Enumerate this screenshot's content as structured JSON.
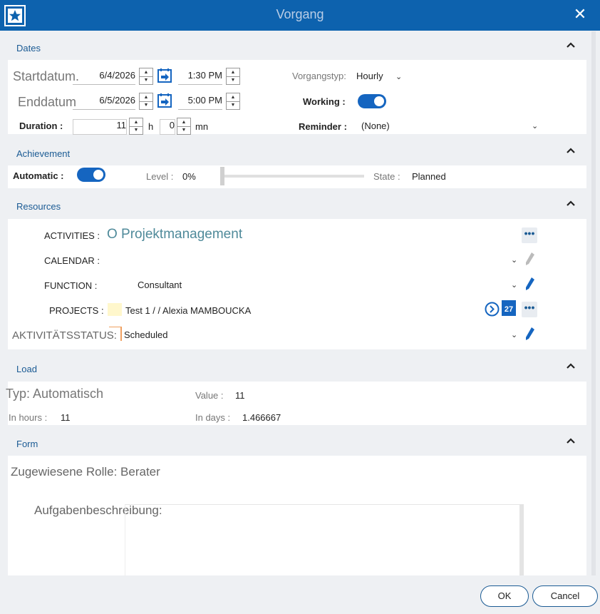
{
  "window": {
    "title": "Vorgang"
  },
  "dates": {
    "section_title": "Dates",
    "start_label": "Startdatum.",
    "start_date": "6/4/2026",
    "start_time": "1:30 PM",
    "end_label": "Enddatum",
    "end_date": "6/5/2026",
    "end_time": "5:00 PM",
    "duration_label": "Duration :",
    "duration_hours": "11",
    "hours_unit": "h",
    "duration_minutes": "0",
    "minutes_unit": "mn",
    "type_label": "Vorgangstyp:",
    "type_value": "Hourly",
    "working_label": "Working :",
    "reminder_label": "Reminder :",
    "reminder_value": "(None)"
  },
  "achievement": {
    "section_title": "Achievement",
    "automatic_label": "Automatic :",
    "level_label": "Level :",
    "level_value": "0%",
    "level_fraction": 0,
    "state_label": "State :",
    "state_value": "Planned"
  },
  "resources": {
    "section_title": "Resources",
    "activities_label": "ACTIVITIES :",
    "activities_value": "O Projektmanagement",
    "calendar_label": "CALENDAR :",
    "function_label": "FUNCTION :",
    "function_value": "Consultant",
    "projects_label": "PROJECTS :",
    "projects_value": "Test 1 /  / Alexia MAMBOUCKA",
    "calendar_badge": "27",
    "status_label": "AKTIVITÄTSSTATUS:",
    "status_value": "Scheduled"
  },
  "load": {
    "section_title": "Load",
    "type_text": "Typ: Automatisch",
    "value_label": "Value :",
    "value": "11",
    "hours_label": "In hours :",
    "hours_value": "11",
    "days_label": "In days :",
    "days_value": "1.466667"
  },
  "form": {
    "section_title": "Form",
    "role_text": "Zugewiesene Rolle: Berater",
    "description_label": "Aufgabenbeschreibung:"
  },
  "footer": {
    "ok_label": "OK",
    "cancel_label": "Cancel"
  },
  "colors": {
    "title_bar": "#0d62ae",
    "accent": "#1565c0",
    "section_title": "#1b5b94",
    "project_swatch": "#fff7cc"
  }
}
